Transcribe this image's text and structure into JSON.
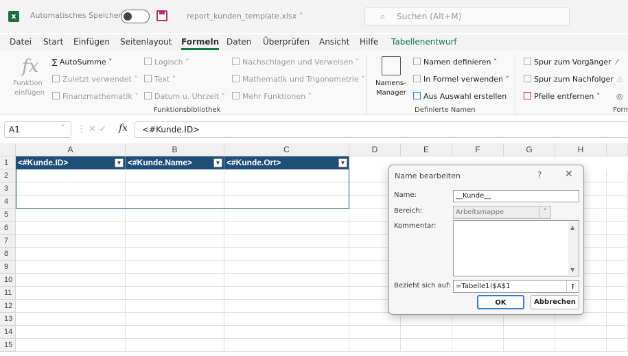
{
  "title_bar": {
    "app_icon": "excel-icon",
    "autosave_label": "Automatisches Speichern",
    "filename": "report_kunden_template.xlsx ˅",
    "search_placeholder": "Suchen (Alt+M)"
  },
  "tabs": [
    "Datei",
    "Start",
    "Einfügen",
    "Seitenlayout",
    "Formeln",
    "Daten",
    "Überprüfen",
    "Ansicht",
    "Hilfe",
    "Tabellenentwurf"
  ],
  "active_tab": "Formeln",
  "ribbon": {
    "insert_function": [
      "Funktion",
      "einfügen"
    ],
    "autosum": "AutoSumme",
    "recent": "Zuletzt verwendet",
    "financial": "Finanzmathematik",
    "logical": "Logisch",
    "text": "Text",
    "datetime": "Datum u. Uhrzeit",
    "lookup": "Nachschlagen und Verweisen",
    "math": "Mathematik und Trigonometrie",
    "more": "Mehr Funktionen",
    "function_library": "Funktionsbibliothek",
    "name_manager": [
      "Namens-",
      "Manager"
    ],
    "define_name": "Namen definieren",
    "use_in_formula": "In Formel verwenden",
    "create_from_selection": "Aus Auswahl erstellen",
    "defined_names": "Definierte Namen",
    "trace_precedents": "Spur zum Vorgänger",
    "trace_dependents": "Spur zum Nachfolger",
    "remove_arrows": "Pfeile entfernen",
    "formula_auditing_partial": "Form"
  },
  "formula_bar": {
    "name_box": "A1",
    "fx": "fx",
    "formula": "<#Kunde.ID>"
  },
  "grid": {
    "columns": [
      "A",
      "B",
      "C",
      "D",
      "E",
      "F",
      "G",
      "H"
    ],
    "rows": [
      "1",
      "2",
      "3",
      "4",
      "5",
      "6",
      "7",
      "8",
      "9",
      "10",
      "11",
      "12",
      "13",
      "14",
      "15"
    ],
    "table_headers": [
      "<#Kunde.ID>",
      "<#Kunde.Name>",
      "<#Kunde.Ort>"
    ]
  },
  "dialog": {
    "title": "Name bearbeiten",
    "help": "?",
    "close": "✕",
    "name_label": "Name:",
    "name_value": "__Kunde__",
    "scope_label": "Bereich:",
    "scope_value": "Arbeitsmappe",
    "comment_label": "Kommentar:",
    "refers_label": "Bezieht sich auf:",
    "refers_value": "=Tabelle1!$A$1",
    "ok": "OK",
    "cancel": "Abbrechen"
  }
}
